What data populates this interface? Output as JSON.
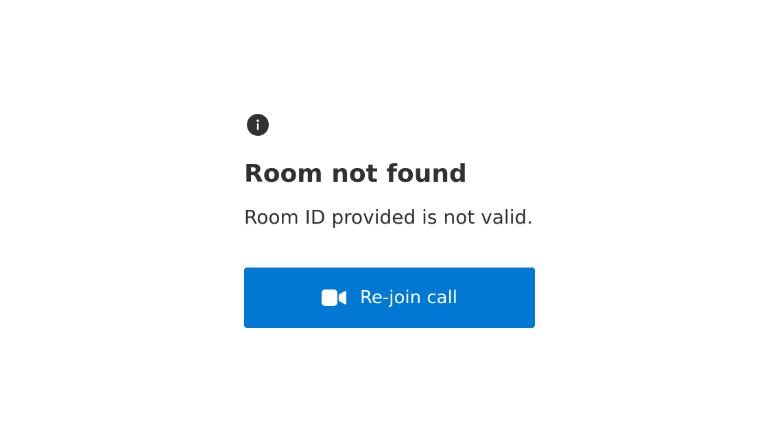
{
  "error": {
    "title": "Room not found",
    "message": "Room ID provided is not valid."
  },
  "actions": {
    "rejoin_label": "Re-join call",
    "rejoin_icon": "video-camera-icon"
  },
  "icons": {
    "status": "info-icon"
  },
  "colors": {
    "primary": "#0078d4",
    "text": "#323130",
    "icon": "#323130",
    "background": "#ffffff"
  }
}
